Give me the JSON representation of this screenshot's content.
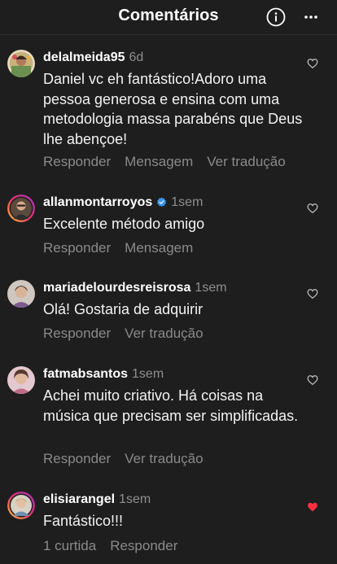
{
  "header": {
    "title": "Comentários",
    "info_icon": "info-icon",
    "more_icon": "more-horizontal-icon"
  },
  "comments": [
    {
      "username": "delalmeida95",
      "time": "6d",
      "verified": false,
      "text": "Daniel vc eh fantástico!Adoro uma pessoa generosa e ensina com uma metodologia massa parabéns que Deus lhe abençoe!",
      "actions": [
        "Responder",
        "Mensagem",
        "Ver tradução"
      ],
      "liked": false
    },
    {
      "username": "allanmontarroyos",
      "time": "1sem",
      "verified": true,
      "text": "Excelente método amigo",
      "actions": [
        "Responder",
        "Mensagem"
      ],
      "liked": false
    },
    {
      "username": "mariadelourdesreisrosa",
      "time": "1sem",
      "verified": false,
      "text": "Olá! Gostaria de adquirir",
      "actions": [
        "Responder",
        "Ver tradução"
      ],
      "liked": false
    },
    {
      "username": "fatmabsantos",
      "time": "1sem",
      "verified": false,
      "text": "Achei muito criativo. Há coisas na música que precisam ser simplificadas.",
      "actions": [
        "Responder",
        "Ver tradução"
      ],
      "liked": false
    },
    {
      "username": "elisiarangel",
      "time": "1sem",
      "verified": false,
      "text": "Fantástico!!!",
      "actions": [
        "1 curtida",
        "Responder"
      ],
      "liked": true
    }
  ],
  "colors": {
    "background": "#1e1e1e",
    "muted_text": "#8a8a8a",
    "verified_badge": "#3897f0",
    "liked_heart": "#ff3040"
  }
}
